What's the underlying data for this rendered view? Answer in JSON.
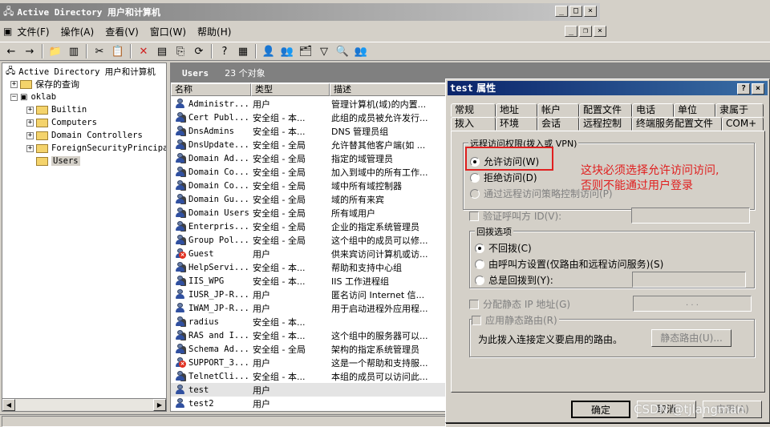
{
  "window": {
    "title": "Active Directory 用户和计算机"
  },
  "menu": [
    "文件(F)",
    "操作(A)",
    "查看(V)",
    "窗口(W)",
    "帮助(H)"
  ],
  "tree": {
    "root": "Active Directory 用户和计算机",
    "saved_queries": "保存的查询",
    "domain": "oklab",
    "children": [
      "Builtin",
      "Computers",
      "Domain Controllers",
      "ForeignSecurityPrincipa",
      "Users"
    ]
  },
  "list": {
    "title": "Users",
    "count": "23 个对象",
    "columns": [
      "名称",
      "类型",
      "描述"
    ],
    "rows": [
      {
        "name": "Administr...",
        "type": "用户",
        "desc": "管理计算机(域)的内置...",
        "icon": "user-icon"
      },
      {
        "name": "Cert Publ...",
        "type": "安全组 - 本...",
        "desc": "此组的成员被允许发行...",
        "icon": "group-icon"
      },
      {
        "name": "DnsAdmins",
        "type": "安全组 - 本...",
        "desc": "DNS 管理员组",
        "icon": "group-icon"
      },
      {
        "name": "DnsUpdate...",
        "type": "安全组 - 全局",
        "desc": "允许替其他客户端(如 ...",
        "icon": "group-icon"
      },
      {
        "name": "Domain Ad...",
        "type": "安全组 - 全局",
        "desc": "指定的域管理员",
        "icon": "group-icon"
      },
      {
        "name": "Domain Co...",
        "type": "安全组 - 全局",
        "desc": "加入到域中的所有工作...",
        "icon": "group-icon"
      },
      {
        "name": "Domain Co...",
        "type": "安全组 - 全局",
        "desc": "域中所有域控制器",
        "icon": "group-icon"
      },
      {
        "name": "Domain Gu...",
        "type": "安全组 - 全局",
        "desc": "域的所有来宾",
        "icon": "group-icon"
      },
      {
        "name": "Domain Users",
        "type": "安全组 - 全局",
        "desc": "所有域用户",
        "icon": "group-icon"
      },
      {
        "name": "Enterpris...",
        "type": "安全组 - 全局",
        "desc": "企业的指定系统管理员",
        "icon": "group-icon"
      },
      {
        "name": "Group Pol...",
        "type": "安全组 - 全局",
        "desc": "这个组中的成员可以修...",
        "icon": "group-icon"
      },
      {
        "name": "Guest",
        "type": "用户",
        "desc": "供来宾访问计算机或访...",
        "icon": "disabled-user-icon"
      },
      {
        "name": "HelpServi...",
        "type": "安全组 - 本...",
        "desc": "帮助和支持中心组",
        "icon": "group-icon"
      },
      {
        "name": "IIS_WPG",
        "type": "安全组 - 本...",
        "desc": "IIS 工作进程组",
        "icon": "group-icon"
      },
      {
        "name": "IUSR_JP-R...",
        "type": "用户",
        "desc": "匿名访问 Internet 信...",
        "icon": "user-icon"
      },
      {
        "name": "IWAM_JP-R...",
        "type": "用户",
        "desc": "用于启动进程外应用程...",
        "icon": "user-icon"
      },
      {
        "name": "radius",
        "type": "安全组 - 本...",
        "desc": "",
        "icon": "group-icon"
      },
      {
        "name": "RAS and I...",
        "type": "安全组 - 本...",
        "desc": "这个组中的服务器可以...",
        "icon": "group-icon"
      },
      {
        "name": "Schema Ad...",
        "type": "安全组 - 全局",
        "desc": "架构的指定系统管理员",
        "icon": "group-icon"
      },
      {
        "name": "SUPPORT_3...",
        "type": "用户",
        "desc": "这是一个帮助和支持服...",
        "icon": "disabled-user-icon"
      },
      {
        "name": "TelnetCli...",
        "type": "安全组 - 本...",
        "desc": "本组的成员可以访问此...",
        "icon": "group-icon"
      },
      {
        "name": "test",
        "type": "用户",
        "desc": "",
        "icon": "user-icon"
      },
      {
        "name": "test2",
        "type": "用户",
        "desc": "",
        "icon": "user-icon"
      }
    ]
  },
  "dialog": {
    "title_name": "test",
    "title_suffix": "属性",
    "tabs_row1": [
      "常规",
      "地址",
      "帐户",
      "配置文件",
      "电话",
      "单位",
      "隶属于"
    ],
    "tabs_row2": [
      "拨入",
      "环境",
      "会话",
      "远程控制",
      "终端服务配置文件",
      "COM+"
    ],
    "remote_group": "远程访问权限(拨入或 VPN)",
    "allow": "允许访问(W)",
    "deny": "拒绝访问(D)",
    "policy": "通过远程访问策略控制访问(P)",
    "verify_caller": "验证呼叫方 ID(V):",
    "callback_group": "回拨选项",
    "no_callback": "不回拨(C)",
    "caller_set": "由呼叫方设置(仅路由和远程访问服务)(S)",
    "always_callback": "总是回拨到(Y):",
    "static_ip": "分配静态 IP 地址(G)",
    "static_ip_value": ".   .   .",
    "static_routes": "应用静态路由(R)",
    "routes_desc": "为此拨入连接定义要启用的路由。",
    "routes_button": "静态路由(U)...",
    "ok": "确定",
    "cancel": "取消",
    "apply": "应用(A)"
  },
  "annotation": {
    "line1": "这块必须选择允许访问访问,",
    "line2": "否则不能通过用户登录"
  },
  "watermark": "CSDN @tjlangman"
}
